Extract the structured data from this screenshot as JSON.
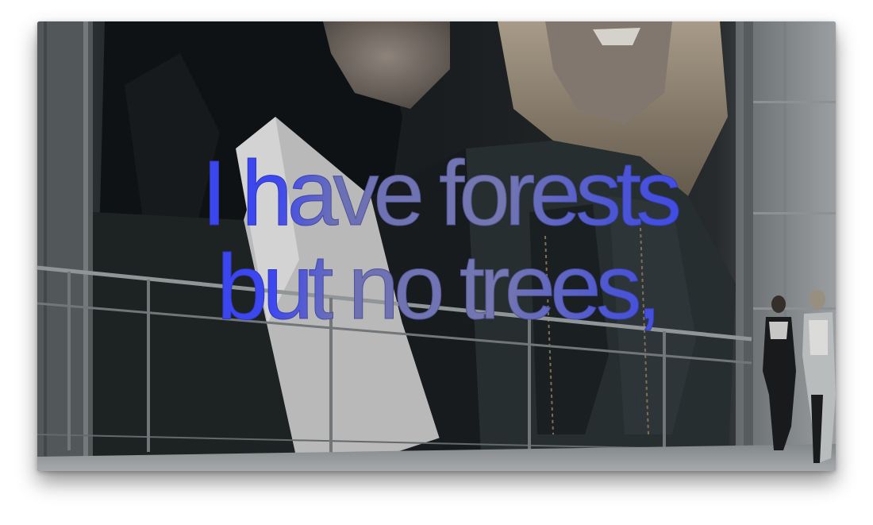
{
  "caption": {
    "line1": "I have forests",
    "line2": "but no trees,"
  },
  "colors": {
    "caption_blue": "#3a44ec",
    "caption_muted": "#7477b0",
    "scene_dark": "#262a2c",
    "wall_grey": "#8c9194"
  }
}
